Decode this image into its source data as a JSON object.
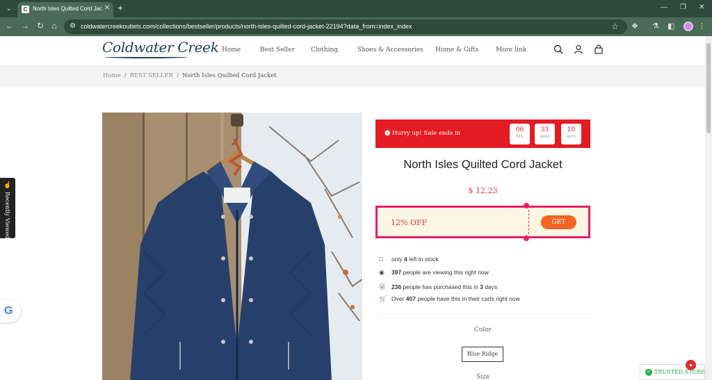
{
  "browser": {
    "tab_title": "North Isles Quilted Cord Jacke",
    "url": "coldwatercreekoutlets.com/collections/bestseller/products/north-isles-quilted-cord-jacket-22194?data_from=index_index",
    "tab_menu_icon": "chevron-down-icon",
    "new_tab_icon": "plus-icon"
  },
  "header": {
    "logo": "Coldwater Creek",
    "nav": [
      "Home",
      "Best Seller",
      "Clothing",
      "Shoes & Accessories",
      "Home & Gifts",
      "More link"
    ],
    "icons": [
      "search-icon",
      "user-icon",
      "cart-icon"
    ]
  },
  "breadcrumb": {
    "home": "Home",
    "sep": "/",
    "section": "BEST SELLER",
    "current": "North Isles Quilted Cord Jacket"
  },
  "countdown": {
    "text": "Hurry up!  Sale ends in",
    "hours": "06",
    "hours_unit": "hrs",
    "mins": "33",
    "mins_unit": "mins",
    "secs": "10",
    "secs_unit": "secs"
  },
  "product": {
    "title": "North Isles Quilted Cord Jacket",
    "price": "$ 12.23"
  },
  "coupon": {
    "label": "12% OFF",
    "button": "GET"
  },
  "stock": {
    "row1_pre": "only ",
    "row1_num": "4",
    "row1_post": " left in stock",
    "row2_num": "397",
    "row2_post": " people are viewing this right now",
    "row3_num": "236",
    "row3_mid": " people has purchased this in ",
    "row3_num2": "3",
    "row3_post": " days",
    "row4_pre": "Over ",
    "row4_num": "407",
    "row4_post": " people have this in their carts right now"
  },
  "options": {
    "color_label": "Color",
    "color_value": "Blue Ridge",
    "size_label": "Size"
  },
  "side": {
    "recently_viewed": "Recently Viewed",
    "trusted_store": "TRUSTED STORE"
  },
  "colors": {
    "chrome_dark": "#2e4a3c",
    "chrome_light": "#4a6b58",
    "sale_red": "#e31b23",
    "coupon_pink": "#e91e63",
    "get_orange": "#f26522",
    "trusted_green": "#2eae4b"
  }
}
